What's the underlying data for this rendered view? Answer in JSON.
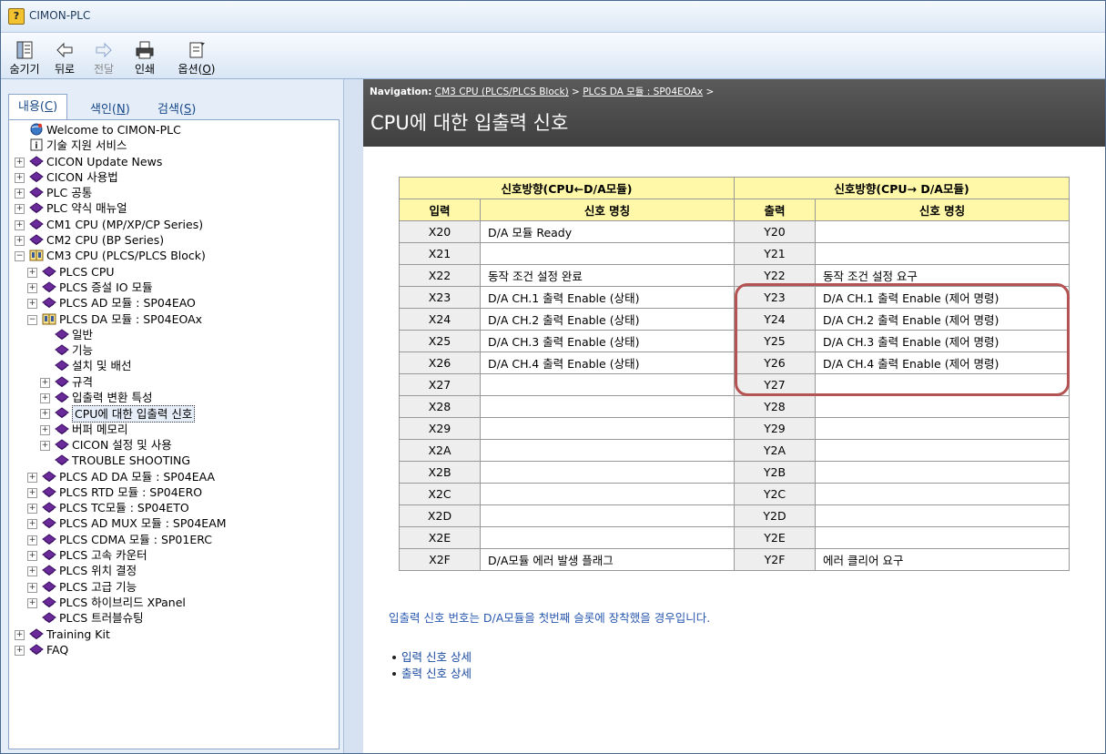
{
  "window": {
    "title": "CIMON-PLC",
    "app_icon": "help-file-icon"
  },
  "toolbar": [
    {
      "label": "숨기기",
      "icon": "hide-pane-icon",
      "enabled": true
    },
    {
      "label": "뒤로",
      "icon": "back-arrow-icon",
      "enabled": true
    },
    {
      "label": "전달",
      "icon": "forward-arrow-icon",
      "enabled": false
    },
    {
      "label": "인쇄",
      "icon": "print-icon",
      "enabled": true
    },
    {
      "label_prefix": "옵션(",
      "label_key": "O",
      "label_suffix": ")",
      "icon": "options-icon",
      "enabled": true
    }
  ],
  "left_tabs": {
    "contents": {
      "prefix": "내용(",
      "key": "C",
      "suffix": ")"
    },
    "index": {
      "prefix": "색인(",
      "key": "N",
      "suffix": ")"
    },
    "search": {
      "prefix": "검색(",
      "key": "S",
      "suffix": ")"
    }
  },
  "tree": [
    {
      "label": "Welcome to CIMON-PLC",
      "level": 0,
      "icon": "welcome",
      "exp": ""
    },
    {
      "label": "기술 지원 서비스",
      "level": 0,
      "icon": "info",
      "exp": ""
    },
    {
      "label": "CICON Update News",
      "level": 0,
      "icon": "book",
      "exp": "+"
    },
    {
      "label": "CICON 사용법",
      "level": 0,
      "icon": "book",
      "exp": "+"
    },
    {
      "label": "PLC 공통",
      "level": 0,
      "icon": "book",
      "exp": "+"
    },
    {
      "label": "PLC 약식 매뉴얼",
      "level": 0,
      "icon": "book",
      "exp": "+"
    },
    {
      "label": "CM1 CPU (MP/XP/CP Series)",
      "level": 0,
      "icon": "book",
      "exp": "+"
    },
    {
      "label": "CM2 CPU (BP Series)",
      "level": 0,
      "icon": "book",
      "exp": "+"
    },
    {
      "label": "CM3 CPU (PLCS/PLCS Block)",
      "level": 0,
      "icon": "openbook",
      "exp": "-"
    },
    {
      "label": "PLCS CPU",
      "level": 1,
      "icon": "book",
      "exp": "+"
    },
    {
      "label": "PLCS 증설 IO 모듈",
      "level": 1,
      "icon": "book",
      "exp": "+"
    },
    {
      "label": "PLCS AD 모듈 : SP04EAO",
      "level": 1,
      "icon": "book",
      "exp": "+"
    },
    {
      "label": "PLCS DA 모듈 : SP04EOAx",
      "level": 1,
      "icon": "openbook",
      "exp": "-"
    },
    {
      "label": "일반",
      "level": 2,
      "icon": "book",
      "exp": ""
    },
    {
      "label": "기능",
      "level": 2,
      "icon": "book",
      "exp": ""
    },
    {
      "label": "설치 및 배선",
      "level": 2,
      "icon": "book",
      "exp": ""
    },
    {
      "label": "규격",
      "level": 2,
      "icon": "book",
      "exp": "+"
    },
    {
      "label": "입출력 변환 특성",
      "level": 2,
      "icon": "book",
      "exp": "+"
    },
    {
      "label": "CPU에 대한 입출력 신호",
      "level": 2,
      "icon": "book",
      "exp": "+",
      "selected": true
    },
    {
      "label": "버퍼 메모리",
      "level": 2,
      "icon": "book",
      "exp": "+"
    },
    {
      "label": "CICON 설정 및 사용",
      "level": 2,
      "icon": "book",
      "exp": "+"
    },
    {
      "label": "TROUBLE SHOOTING",
      "level": 2,
      "icon": "book",
      "exp": ""
    },
    {
      "label": "PLCS AD DA 모듈 : SP04EAA",
      "level": 1,
      "icon": "book",
      "exp": "+"
    },
    {
      "label": "PLCS RTD 모듈 : SP04ERO",
      "level": 1,
      "icon": "book",
      "exp": "+"
    },
    {
      "label": "PLCS TC모듈 : SP04ETO",
      "level": 1,
      "icon": "book",
      "exp": "+"
    },
    {
      "label": "PLCS AD MUX 모듈 : SP04EAM",
      "level": 1,
      "icon": "book",
      "exp": "+"
    },
    {
      "label": "PLCS CDMA 모듈 : SP01ERC",
      "level": 1,
      "icon": "book",
      "exp": "+"
    },
    {
      "label": "PLCS 고속 카운터",
      "level": 1,
      "icon": "book",
      "exp": "+"
    },
    {
      "label": "PLCS 위치 결정",
      "level": 1,
      "icon": "book",
      "exp": "+"
    },
    {
      "label": "PLCS 고급 기능",
      "level": 1,
      "icon": "book",
      "exp": "+"
    },
    {
      "label": "PLCS 하이브리드 XPanel",
      "level": 1,
      "icon": "book",
      "exp": "+"
    },
    {
      "label": "PLCS 트러블슈팅",
      "level": 1,
      "icon": "book",
      "exp": ""
    },
    {
      "label": "Training Kit",
      "level": 0,
      "icon": "book",
      "exp": "+"
    },
    {
      "label": "FAQ",
      "level": 0,
      "icon": "book",
      "exp": "+"
    }
  ],
  "content": {
    "nav_label": "Navigation:",
    "nav_links": [
      "CM3 CPU (PLCS/PLCS Block)",
      "PLCS DA 모듈 : SP04EOAx"
    ],
    "nav_sep": ">",
    "title": "CPU에 대한 입출력 신호",
    "table": {
      "group_input": "신호방향(CPU←D/A모듈)",
      "group_output": "신호방향(CPU→ D/A모듈)",
      "col_input": "입력",
      "col_output": "출력",
      "col_name": "신호 명칭",
      "rows": [
        {
          "x": "X20",
          "xn": "D/A 모듈 Ready",
          "y": "Y20",
          "yn": ""
        },
        {
          "x": "X21",
          "xn": "",
          "y": "Y21",
          "yn": ""
        },
        {
          "x": "X22",
          "xn": "동작 조건 설정 완료",
          "y": "Y22",
          "yn": "동작 조건 설정 요구"
        },
        {
          "x": "X23",
          "xn": "D/A CH.1 출력 Enable (상태)",
          "y": "Y23",
          "yn": "D/A CH.1 출력 Enable (제어 명령)"
        },
        {
          "x": "X24",
          "xn": "D/A CH.2 출력 Enable (상태)",
          "y": "Y24",
          "yn": "D/A CH.2 출력 Enable (제어 명령)"
        },
        {
          "x": "X25",
          "xn": "D/A CH.3 출력 Enable (상태)",
          "y": "Y25",
          "yn": "D/A CH.3 출력 Enable (제어 명령)"
        },
        {
          "x": "X26",
          "xn": "D/A CH.4 출력 Enable (상태)",
          "y": "Y26",
          "yn": "D/A CH.4 출력 Enable (제어 명령)"
        },
        {
          "x": "X27",
          "xn": "",
          "y": "Y27",
          "yn": ""
        },
        {
          "x": "X28",
          "xn": "",
          "y": "Y28",
          "yn": ""
        },
        {
          "x": "X29",
          "xn": "",
          "y": "Y29",
          "yn": ""
        },
        {
          "x": "X2A",
          "xn": "",
          "y": "Y2A",
          "yn": ""
        },
        {
          "x": "X2B",
          "xn": "",
          "y": "Y2B",
          "yn": ""
        },
        {
          "x": "X2C",
          "xn": "",
          "y": "Y2C",
          "yn": ""
        },
        {
          "x": "X2D",
          "xn": "",
          "y": "Y2D",
          "yn": ""
        },
        {
          "x": "X2E",
          "xn": "",
          "y": "Y2E",
          "yn": ""
        },
        {
          "x": "X2F",
          "xn": "D/A모듈 에러 발생 플래그",
          "y": "Y2F",
          "yn": "에러 클리어 요구"
        }
      ]
    },
    "note": "입출력 신호 번호는 D/A모듈을 첫번째 슬롯에 장착했을 경우입니다.",
    "links": [
      "입력 신호 상세",
      "출력 신호 상세"
    ]
  },
  "colors": {
    "header_bg": "#4a4a4a",
    "table_header_bg": "#fff8a8",
    "highlight": "#b55353",
    "link": "#2a58b0"
  }
}
